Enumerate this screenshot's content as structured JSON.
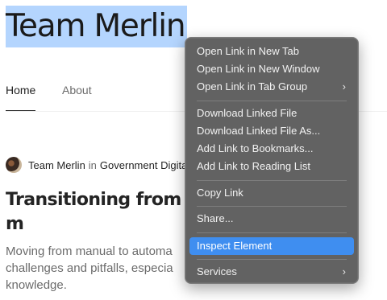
{
  "page": {
    "title": "Team Merlin"
  },
  "nav": {
    "tabs": [
      "Home",
      "About"
    ]
  },
  "article": {
    "author": "Team Merlin",
    "in_word": "in",
    "publication": "Government Digita",
    "headline": "Transitioning from m\ntesting",
    "subtitle": "Moving from manual to automa\nchallenges and pitfalls, especia\nknowledge."
  },
  "context_menu": {
    "items": {
      "open_new_tab": "Open Link in New Tab",
      "open_new_window": "Open Link in New Window",
      "open_tab_group": "Open Link in Tab Group",
      "download_linked_file": "Download Linked File",
      "download_linked_file_as": "Download Linked File As...",
      "add_to_bookmarks": "Add Link to Bookmarks...",
      "add_to_reading_list": "Add Link to Reading List",
      "copy_link": "Copy Link",
      "share": "Share...",
      "inspect_element": "Inspect Element",
      "services": "Services"
    },
    "highlighted_item": "Inspect Element",
    "submenu_arrow": "›"
  },
  "colors": {
    "title_selection": "#b4d5fe",
    "menu_background": "#626262",
    "menu_highlight": "#3f8ef0"
  }
}
